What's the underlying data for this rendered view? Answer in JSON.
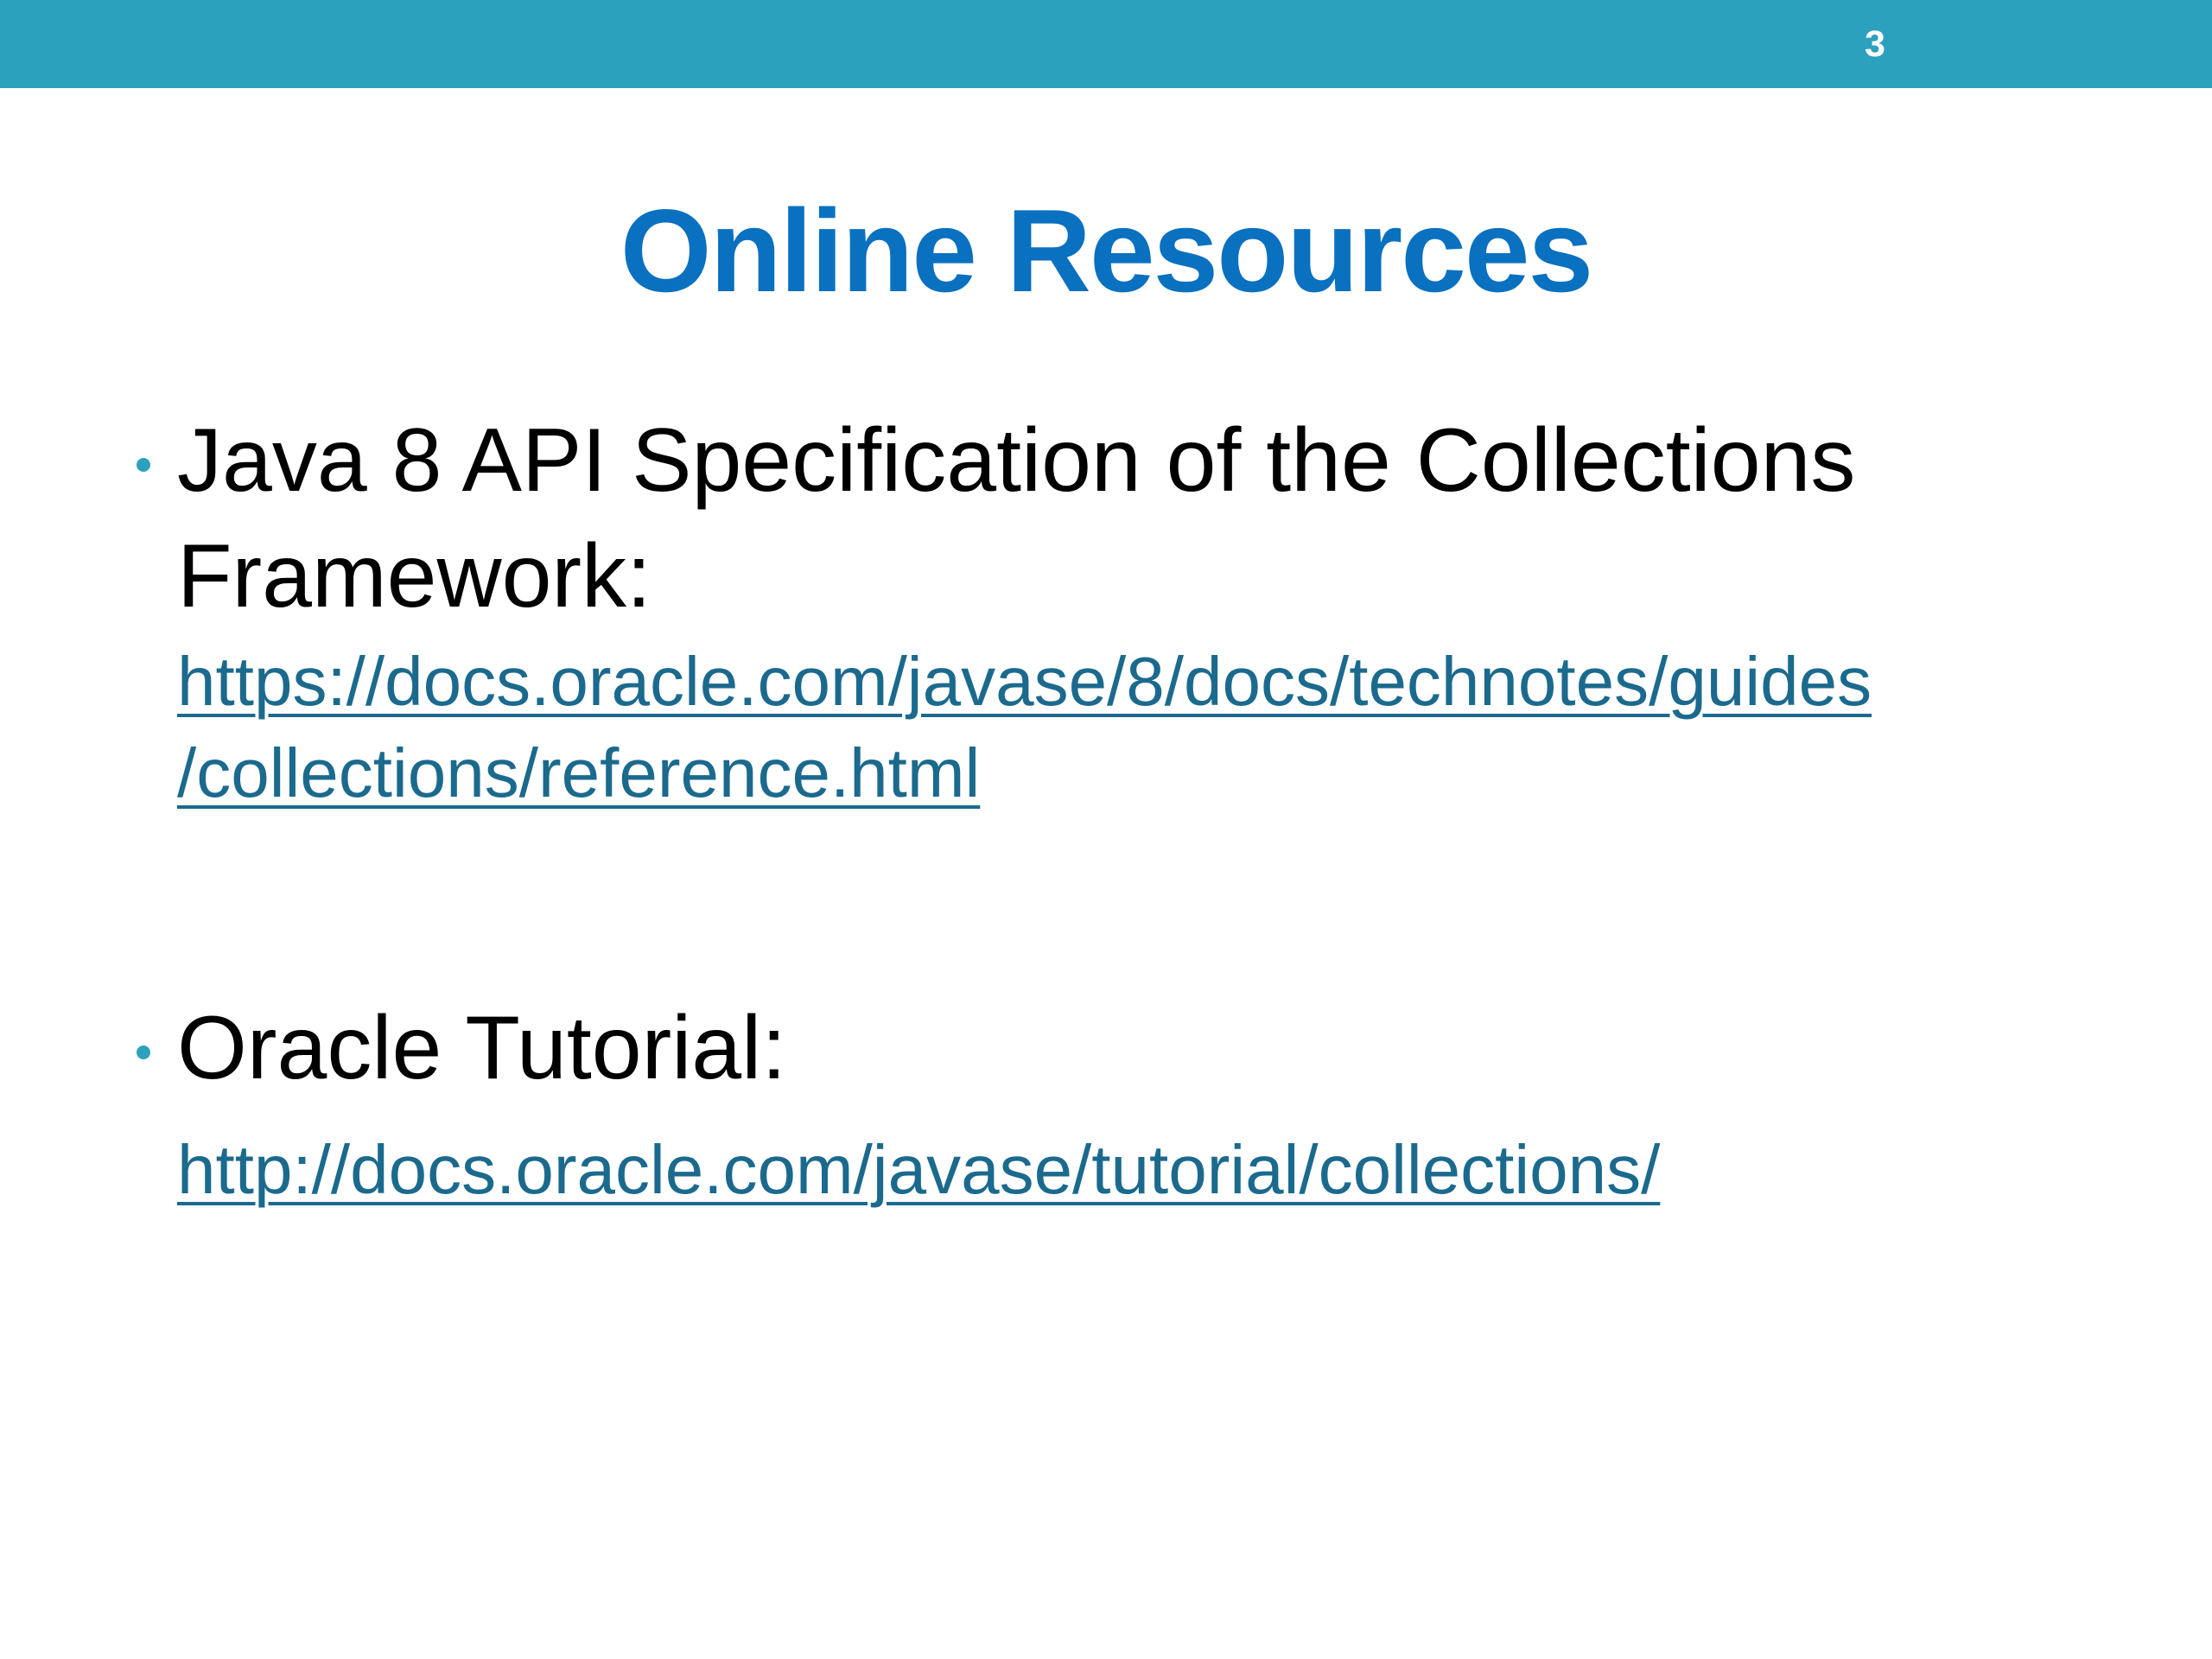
{
  "slide": {
    "number": "3",
    "title": "Online Resources",
    "bullets": [
      {
        "text_line1": "Java 8 API Specification of the Collections",
        "text_line2": "Framework:",
        "link_line1": "https://docs.oracle.com/javase/8/docs/technotes/guides",
        "link_line2": "/collections/reference.html"
      },
      {
        "text_line1": "Oracle Tutorial:",
        "link_line1": "http://docs.oracle.com/javase/tutorial/collections/"
      }
    ]
  },
  "colors": {
    "header_bar": "#2ca1be",
    "title": "#0a70c0",
    "link": "#1b6a8e",
    "bullet": "#2ca1be"
  }
}
